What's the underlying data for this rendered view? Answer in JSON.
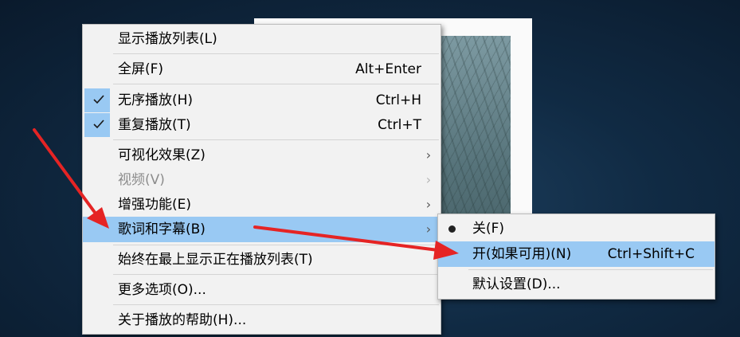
{
  "menu": {
    "show_playlist": "显示播放列表(L)",
    "fullscreen": {
      "label": "全屏(F)",
      "shortcut": "Alt+Enter"
    },
    "shuffle": {
      "label": "无序播放(H)",
      "shortcut": "Ctrl+H",
      "checked": true
    },
    "repeat": {
      "label": "重复播放(T)",
      "shortcut": "Ctrl+T",
      "checked": true
    },
    "visualizations": "可视化效果(Z)",
    "video": "视频(V)",
    "enhancements": "增强功能(E)",
    "lyrics_captions": "歌词和字幕(B)",
    "always_on_top": "始终在最上显示正在播放列表(T)",
    "more_options": "更多选项(O)...",
    "help": "关于播放的帮助(H)...",
    "submenu_arrow": "›"
  },
  "submenu": {
    "off": "关(F)",
    "on_if_available": {
      "label": "开(如果可用)(N)",
      "shortcut": "Ctrl+Shift+C"
    },
    "default_settings": "默认设置(D)..."
  },
  "colors": {
    "highlight": "#99c9f3",
    "annotation_arrow": "#e52424"
  },
  "icons": [
    "check-icon",
    "radio-dot-icon",
    "chevron-right-icon",
    "red-arrow"
  ]
}
